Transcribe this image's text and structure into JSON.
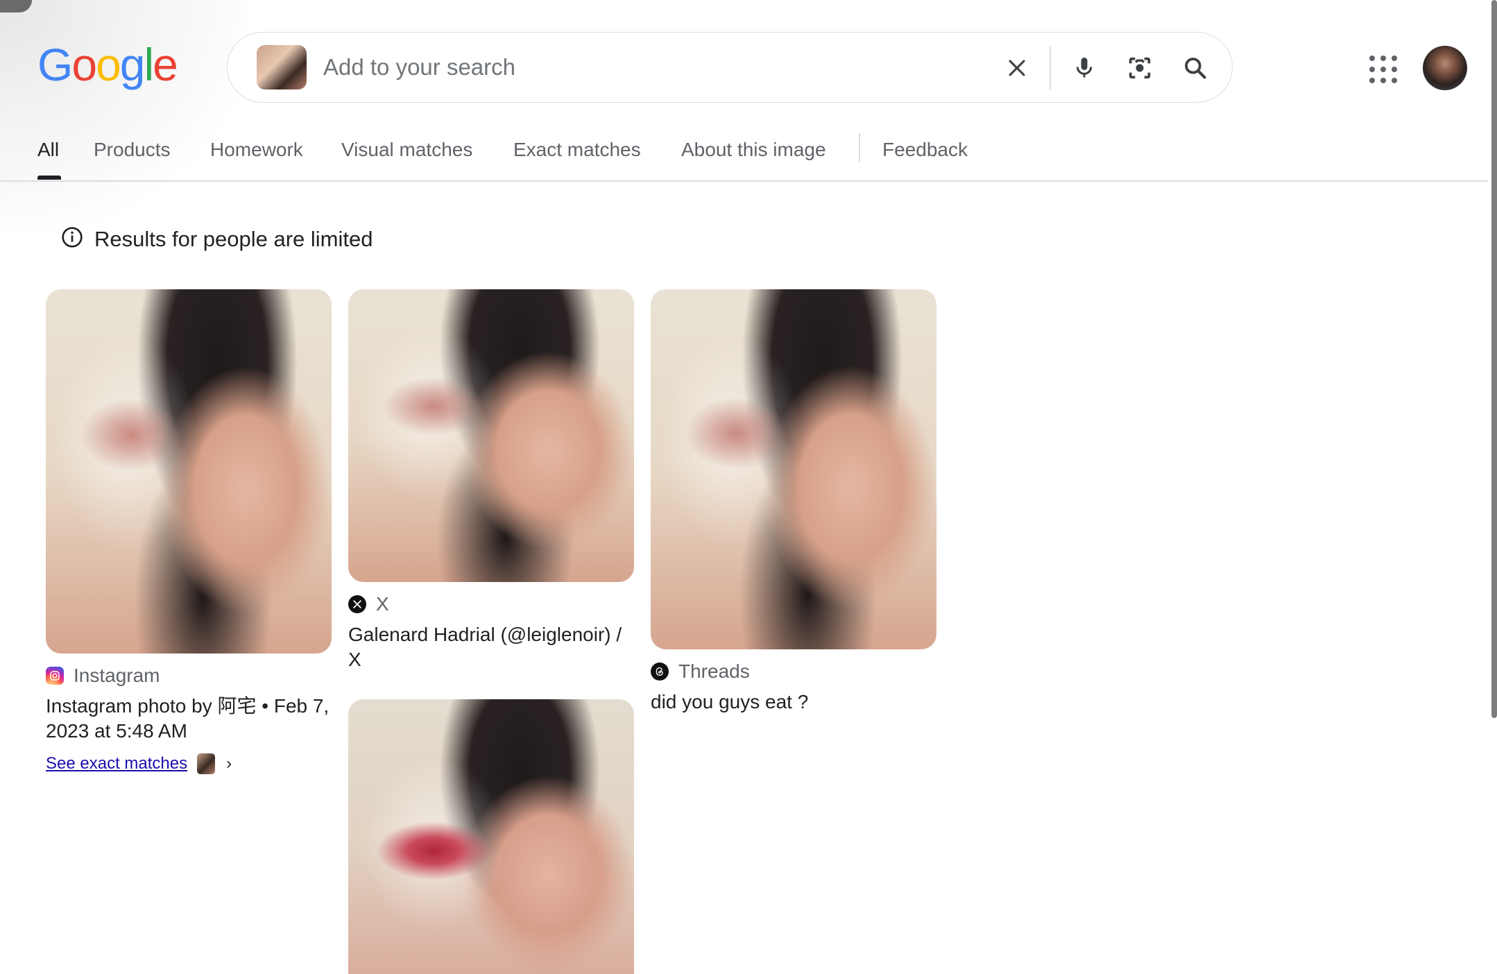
{
  "header": {
    "logo_text": "Google",
    "search": {
      "placeholder": "Add to your search",
      "icons": {
        "clear": "close-icon",
        "mic": "microphone-icon",
        "lens": "camera-lens-icon",
        "search": "search-icon"
      }
    },
    "apps_icon": "apps-grid-icon",
    "avatar": "user-avatar"
  },
  "tabs": [
    {
      "label": "All",
      "active": true
    },
    {
      "label": "Products"
    },
    {
      "label": "Homework"
    },
    {
      "label": "Visual matches"
    },
    {
      "label": "Exact matches"
    },
    {
      "label": "About this image"
    },
    {
      "label": "Feedback"
    }
  ],
  "notice": {
    "text": "Results for people are limited",
    "icon": "info-icon"
  },
  "results": [
    {
      "source": "Instagram",
      "source_icon": "instagram-icon",
      "title": "Instagram photo by 阿宅 • Feb 7, 2023 at 5:48 AM",
      "exact_link": "See exact matches"
    },
    {
      "source": "X",
      "source_icon": "x-icon",
      "title": "Galenard Hadrial (@leiglenoir) / X"
    },
    {
      "source": "Threads",
      "source_icon": "threads-icon",
      "title": "did you guys eat ?"
    }
  ],
  "colors": {
    "link": "#1a0dab",
    "text": "#202124",
    "muted": "#5f6368",
    "border": "#dadce0"
  }
}
